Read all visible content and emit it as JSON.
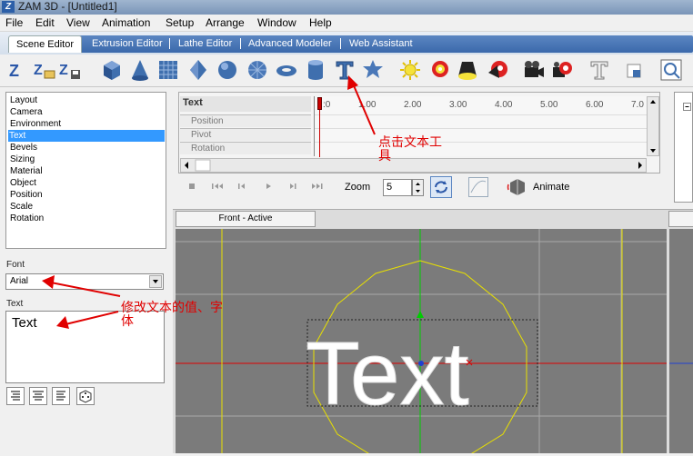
{
  "window": {
    "title": "ZAM 3D - [Untitled1]"
  },
  "menu": [
    "File",
    "Edit",
    "View",
    "Animation",
    "Setup",
    "Arrange",
    "Window",
    "Help"
  ],
  "tabs": [
    "Scene Editor",
    "Extrusion Editor",
    "Lathe Editor",
    "Advanced Modeler",
    "Web Assistant"
  ],
  "toolbar": {
    "icons": [
      "new-scene-icon",
      "open-scene-icon",
      "save-scene-icon",
      "cube-icon",
      "cone-icon",
      "grid-icon",
      "diamond-icon",
      "sphere-icon",
      "geodesic-icon",
      "torus-icon",
      "cylinder-icon",
      "text-tool-icon",
      "star-icon",
      "light-icon",
      "spotlight-icon",
      "bulb-icon",
      "spot-light-icon",
      "camera-icon",
      "camera-target-icon",
      "text-style-icon",
      "square-icon",
      "preview-icon"
    ]
  },
  "object_list": {
    "items": [
      "Layout",
      "Camera",
      "Environment",
      "Text",
      "Bevels",
      "Sizing",
      "Material",
      "Object",
      "Position",
      "Scale",
      "Rotation"
    ],
    "selected": "Text"
  },
  "font": {
    "label": "Font",
    "value": "Arial"
  },
  "text_field": {
    "label": "Text",
    "value": "Text"
  },
  "timeline": {
    "object": "Text",
    "tracks": [
      "Position",
      "Pivot",
      "Rotation"
    ],
    "ticks": [
      ":0",
      "1.00",
      "2.00",
      "3.00",
      "4.00",
      "5.00",
      "6.00",
      "7.0"
    ]
  },
  "controls": {
    "zoom_label": "Zoom",
    "zoom_value": "5",
    "animate_label": "Animate"
  },
  "viewport": {
    "tab_label": "Front - Active",
    "rendered_text": "Text"
  },
  "annotations": {
    "text_tool": "点击文本工\n具",
    "modify_text": "修改文本的值、字\n体"
  },
  "colors": {
    "accent": "#3b69ab",
    "annotation": "#e00000",
    "selection": "#3399ff",
    "viewport_bg": "#7b7b7b"
  }
}
